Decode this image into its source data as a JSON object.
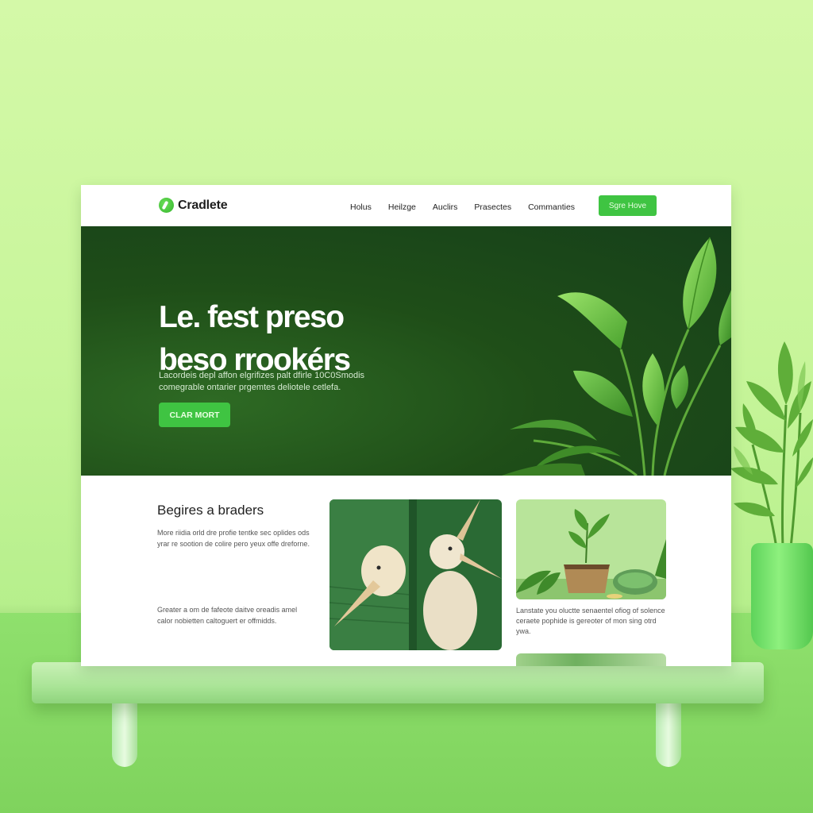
{
  "brand": {
    "name": "Cradlete"
  },
  "nav": {
    "links": [
      "Holus",
      "Heilzge",
      "Auclirs",
      "Prasectes",
      "Commanties"
    ],
    "cta_label": "Sgre Hove"
  },
  "hero": {
    "title_line1": "Le. fest preso",
    "title_line2": "beso rrookérs",
    "subtitle_line1": "Lacordeis depl affon elgrifizes palt dfirle 10C0Smodis",
    "subtitle_line2": "comegrable ontarier prgemtes deliotele cetlefa.",
    "button_label": "CLAR MORT"
  },
  "section": {
    "title": "Begires a braders",
    "text1_line1": "More riidia orld dre profie tentke sec oplides ods",
    "text1_line2": "yrar re sootion de colire pero yeux offe dreforne.",
    "text2_line1": "Greater a om de fafeote daitve oreadis amel",
    "text2_line2": "calor nobietten caltoguert er offmidds.",
    "card_text_line1": "Lanstate you oluctte senaentel ofiog of solence",
    "card_text_line2": "ceraete pophide is gereoter of mon sing otrd",
    "card_text_line3": "ywa."
  },
  "colors": {
    "accent": "#3fc442",
    "hero_bg": "#1f4e18",
    "backdrop": "#c7f59a"
  }
}
